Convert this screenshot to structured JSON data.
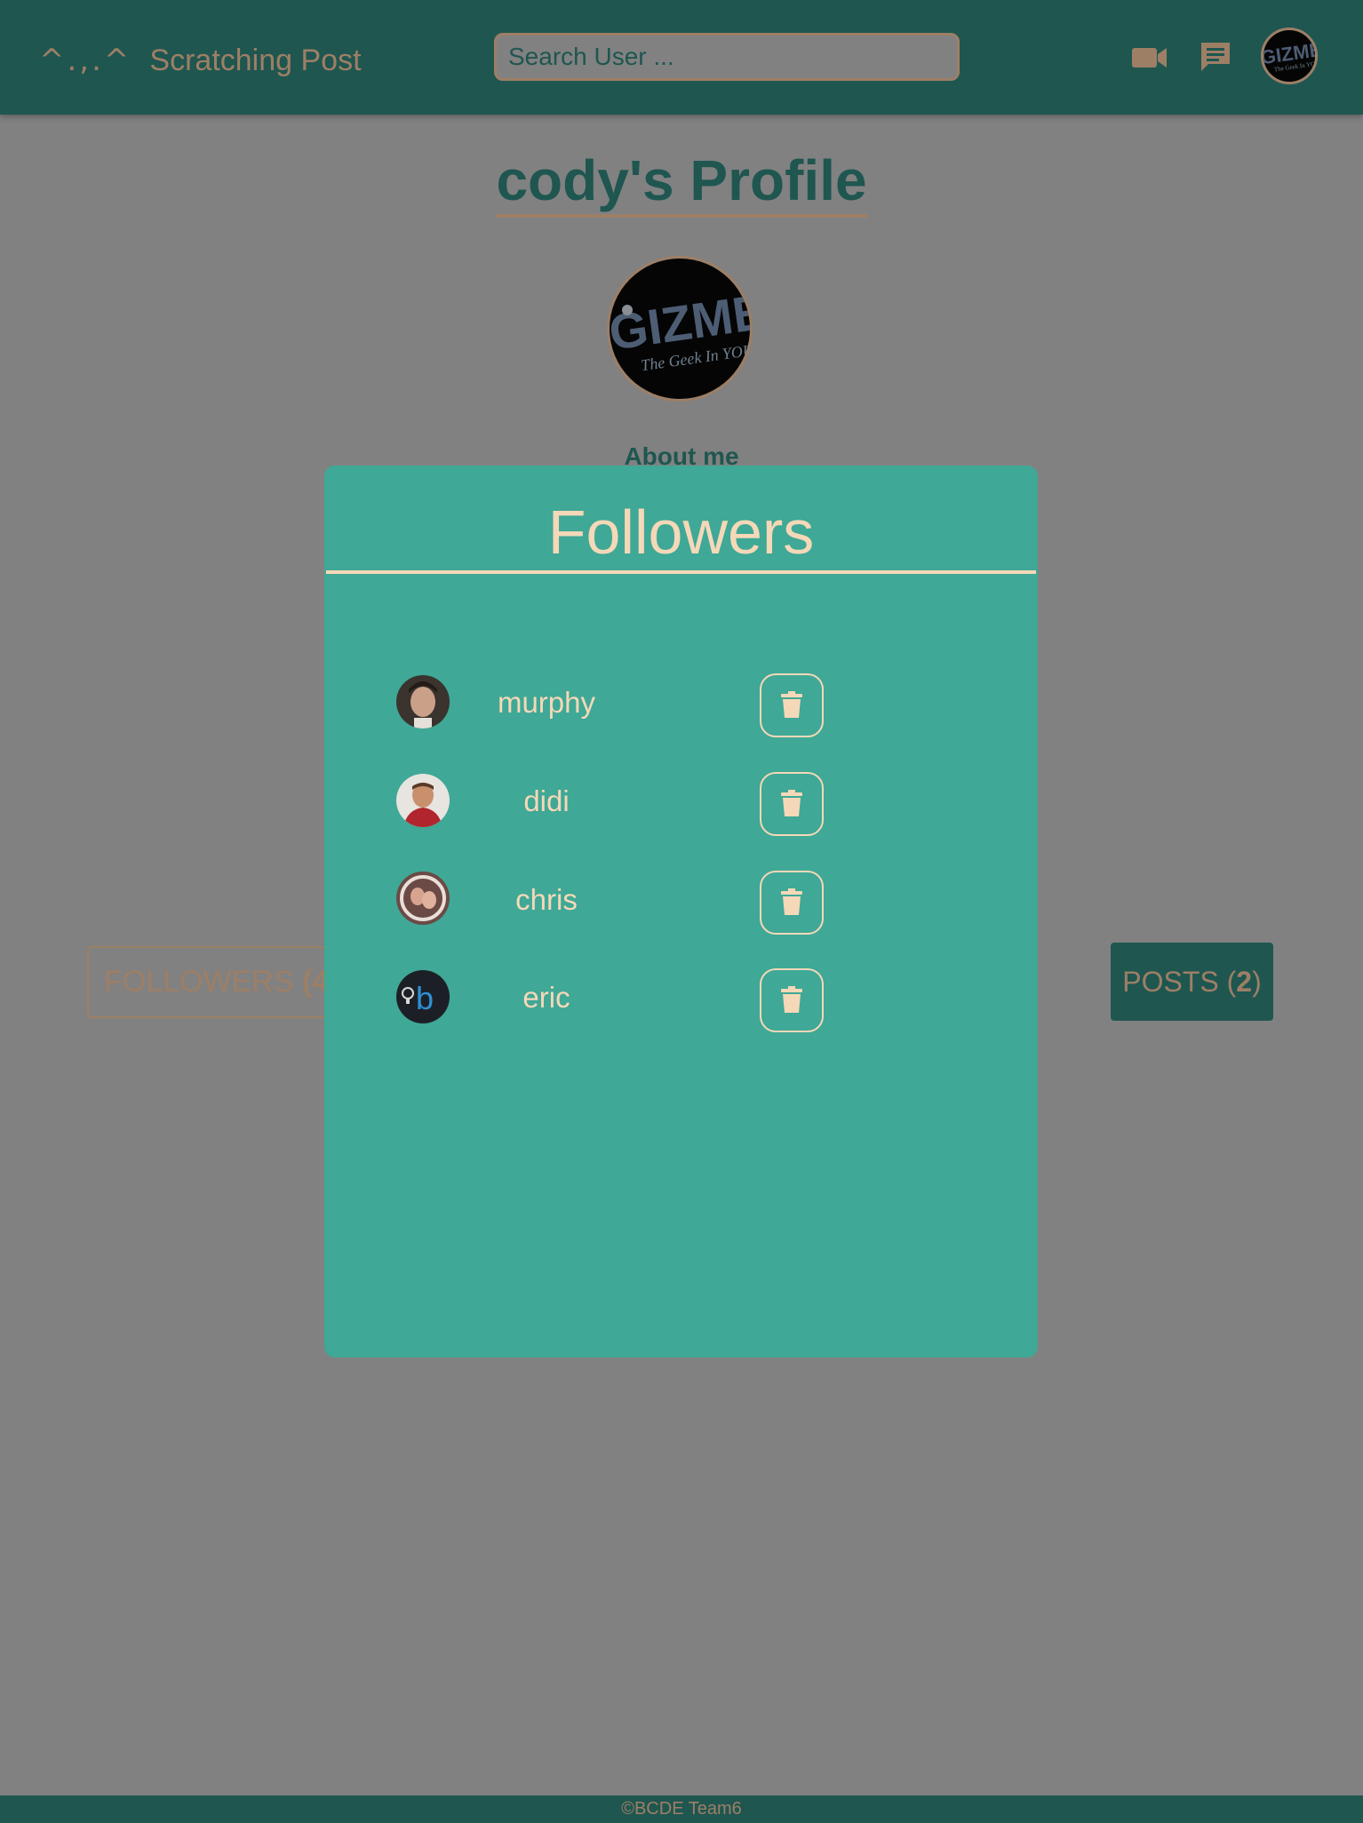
{
  "nav": {
    "logo": "^.,.^",
    "brand": "Scratching Post",
    "search_placeholder": "Search User ...",
    "icons": [
      "video-camera-icon",
      "chat-icon",
      "user-avatar"
    ]
  },
  "profile": {
    "title": "cody's Profile",
    "about_heading": "About me",
    "followers_label": "FOLLOWERS",
    "followers_count": "(4",
    "posts_label": "POSTS",
    "posts_count": "2"
  },
  "modal": {
    "title": "Followers",
    "followers": [
      {
        "name": "murphy"
      },
      {
        "name": "didi"
      },
      {
        "name": "chris"
      },
      {
        "name": "eric"
      }
    ]
  },
  "footer": {
    "text": "©BCDE Team6"
  },
  "colors": {
    "navbar": "#1f5650",
    "accent": "#9d7f66",
    "overlay_bg": "#818181",
    "modal_bg": "#3fa896",
    "modal_text": "#f5d8b8"
  }
}
